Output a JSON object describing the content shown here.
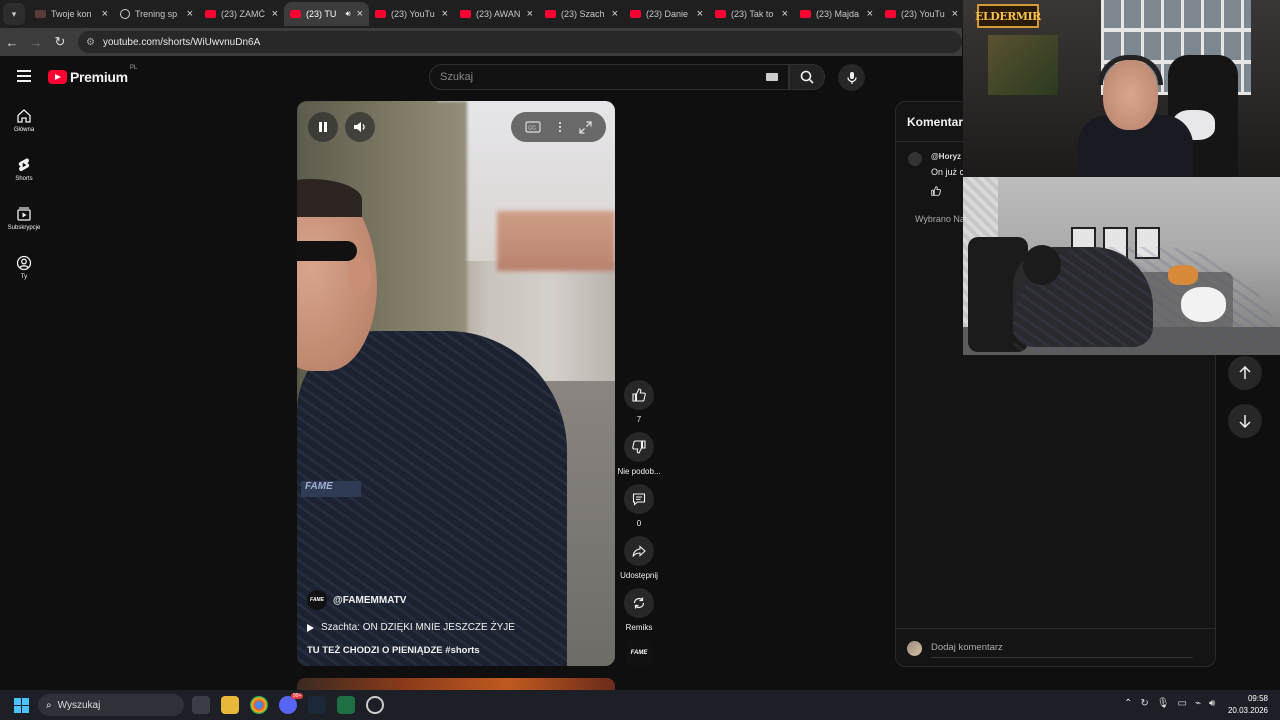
{
  "browser": {
    "tabs": [
      {
        "label": "Twoje kon",
        "icon": "doc-icon"
      },
      {
        "label": "Trening sp",
        "icon": "globe-icon"
      },
      {
        "label": "(23) ZAMĆ",
        "icon": "youtube-icon"
      },
      {
        "label": "(23) TU",
        "icon": "youtube-icon",
        "active": true
      },
      {
        "label": "(23) YouTu",
        "icon": "youtube-icon"
      },
      {
        "label": "(23) AWAN",
        "icon": "youtube-icon"
      },
      {
        "label": "(23) Szach",
        "icon": "youtube-icon"
      },
      {
        "label": "(23) Danie",
        "icon": "youtube-icon"
      },
      {
        "label": "(23) Tak to",
        "icon": "youtube-icon"
      },
      {
        "label": "(23) Majda",
        "icon": "youtube-icon"
      },
      {
        "label": "(23) YouTu",
        "icon": "youtube-icon"
      }
    ],
    "url": "youtube.com/shorts/WiUwvnuDn6A"
  },
  "youtube": {
    "logo_text": "Premium",
    "region": "PL",
    "search_placeholder": "Szukaj",
    "guide": [
      {
        "label": "Główna",
        "icon": "home-icon"
      },
      {
        "label": "Shorts",
        "icon": "shorts-icon"
      },
      {
        "label": "Subskrypcje",
        "icon": "subscriptions-icon"
      },
      {
        "label": "Ty",
        "icon": "account-icon"
      }
    ]
  },
  "short": {
    "overlay_text": "FAME",
    "channel_avatar_text": "FAME",
    "channel": "@FAMEMMATV",
    "related_video": "Szachta: ON DZIĘKI MNIE JESZCZE ŻYJE",
    "description_text": "TU TEŻ CHODZI O PIENIĄDZE",
    "hashtag": "#shorts",
    "actions": {
      "likes": "7",
      "dislike_label": "Nie podob...",
      "comments": "0",
      "share_label": "Udostępnij",
      "remix_label": "Remiks"
    }
  },
  "comments_panel": {
    "title": "Komentarz",
    "first_comment_author": "@Horyz",
    "first_comment_text": "On już c",
    "selected_text": "Wybrano Na",
    "add_comment_placeholder": "Dodaj komentarz"
  },
  "stream_overlay": {
    "logo_text": "ELDERMIR"
  },
  "taskbar": {
    "search_label": "Wyszukaj",
    "time": "09:58",
    "date": "20.03.2026",
    "notification_badge": "99+"
  },
  "colors": {
    "youtube_red": "#ff0033",
    "windows_blue": "#4cc2ff"
  }
}
